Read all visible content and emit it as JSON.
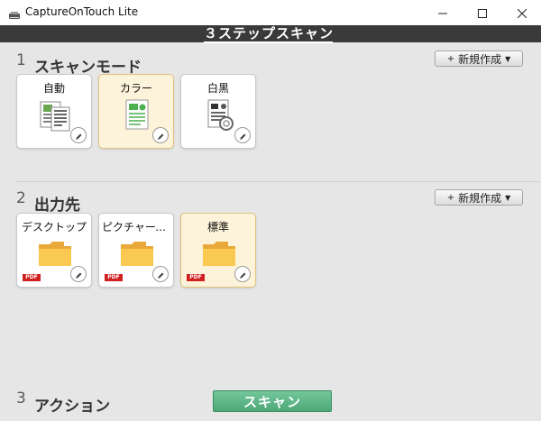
{
  "window": {
    "title": "CaptureOnTouch Lite"
  },
  "header": {
    "title": "３ステップスキャン"
  },
  "sections": [
    {
      "number": "1",
      "title": "スキャンモード",
      "new_button": "新規作成"
    },
    {
      "number": "2",
      "title": "出力先",
      "new_button": "新規作成"
    },
    {
      "number": "3",
      "title": "アクション"
    }
  ],
  "scan_modes": [
    {
      "label": "自動",
      "selected": false
    },
    {
      "label": "カラー",
      "selected": true
    },
    {
      "label": "白黒",
      "selected": false
    }
  ],
  "destinations": [
    {
      "label": "デスクトップ",
      "badge": "PDF",
      "selected": false
    },
    {
      "label": "ピクチャーフ…",
      "badge": "PDF",
      "selected": false
    },
    {
      "label": "標準",
      "badge": "PDF",
      "selected": true
    }
  ],
  "action": {
    "scan_label": "スキャン"
  },
  "colors": {
    "header_bg": "#3a3a3a",
    "selected_card": "#fdf3da",
    "scan_button": "#5cb585",
    "pdf_badge": "#d12020"
  },
  "icons": {
    "edit": "pencil-icon",
    "window": [
      "minimize-icon",
      "maximize-icon",
      "close-icon"
    ],
    "card_images": [
      "auto-document-icon",
      "color-document-icon",
      "bw-document-icon",
      "folder-icon"
    ]
  }
}
